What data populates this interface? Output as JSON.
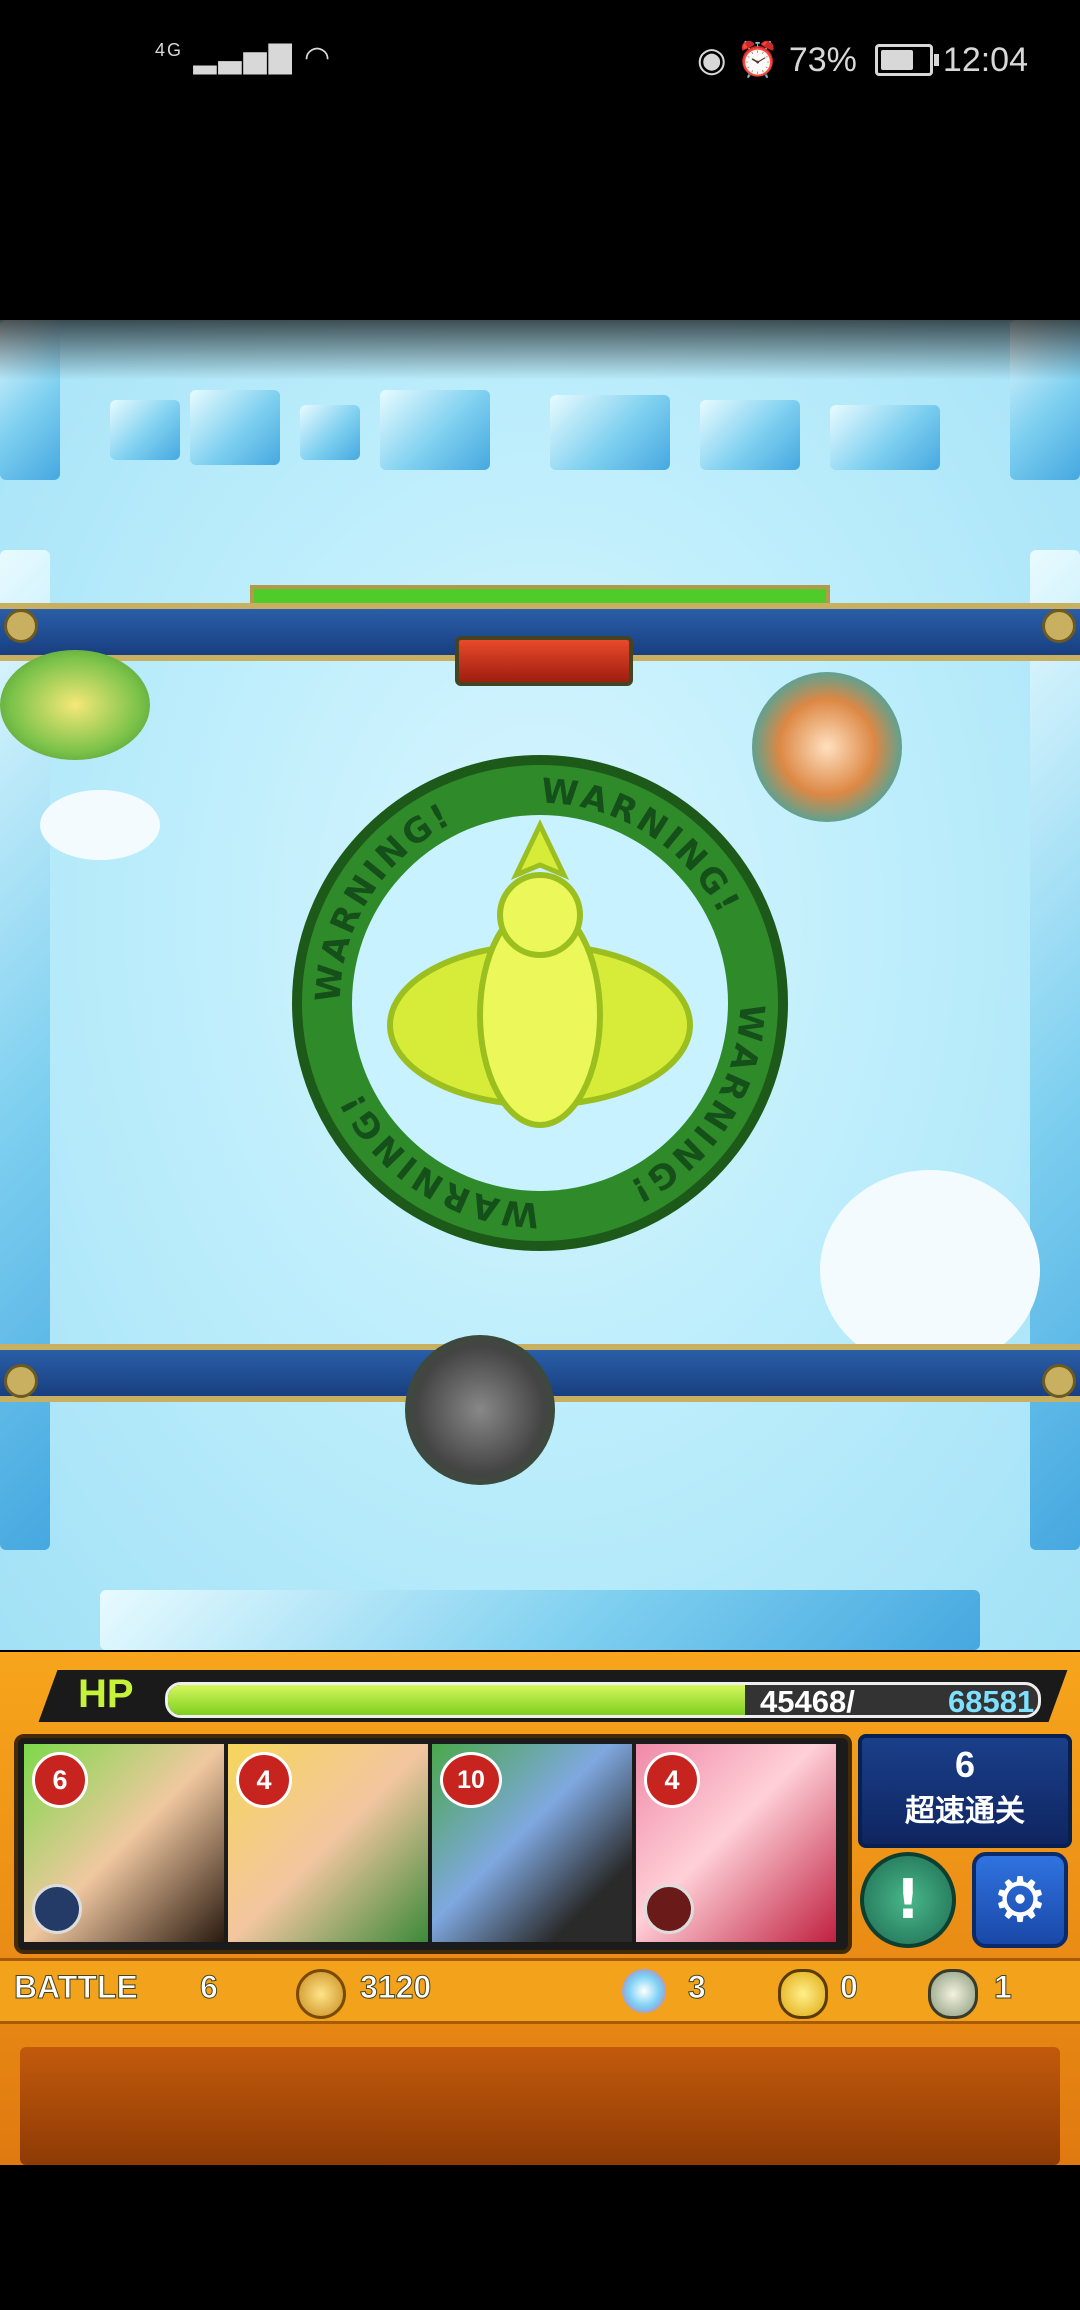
{
  "status_bar": {
    "network": "4G",
    "battery_percent": "73%",
    "battery_level": 0.73,
    "time": "12:04"
  },
  "stage": {
    "warning_text": "WARNING!"
  },
  "hud": {
    "hp_label": "HP",
    "hp_current": "45468/",
    "hp_max": "68581",
    "hp_fraction": 0.663,
    "team": [
      {
        "turns": "6",
        "element": "water"
      },
      {
        "turns": "4",
        "element": ""
      },
      {
        "turns": "10",
        "element": ""
      },
      {
        "turns": "4",
        "element": "fire"
      }
    ],
    "speed_clear": {
      "number": "6",
      "label": "超速通关"
    },
    "battle_label": "BATTLE",
    "battle_number": "6",
    "coins": "3120",
    "orbs": "3",
    "gold_eggs": "0",
    "eggs": "1"
  },
  "colors": {
    "hud_orange": "#f7a51c",
    "hp_green": "#7fcf1f",
    "warning_green": "#2f8a2a"
  }
}
